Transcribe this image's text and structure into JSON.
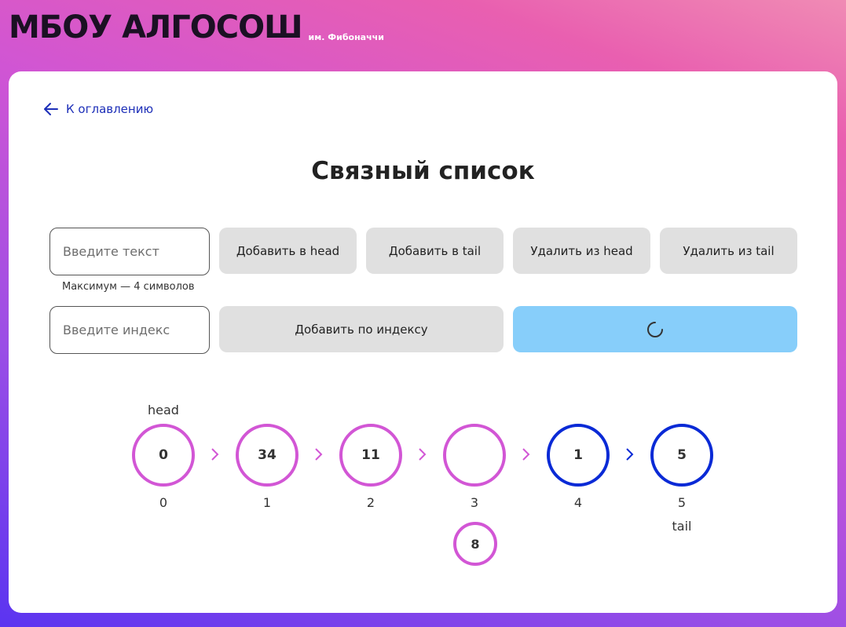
{
  "header": {
    "title": "МБОУ АЛГОСОШ",
    "subtitle": "им. Фибоначчи"
  },
  "nav": {
    "back_label": "К оглавлению"
  },
  "page": {
    "title": "Связный список"
  },
  "controls": {
    "text_input": {
      "placeholder": "Введите текст",
      "value": ""
    },
    "text_hint": "Максимум — 4 символов",
    "index_input": {
      "placeholder": "Введите индекс",
      "value": ""
    },
    "add_head": "Добавить в head",
    "add_tail": "Добавить в tail",
    "remove_head": "Удалить из head",
    "remove_tail": "Удалить из tail",
    "add_by_index": "Добавить по индексу",
    "loading_button_state": "loading"
  },
  "list": {
    "head_label": "head",
    "tail_label": "tail",
    "nodes": [
      {
        "value": "0",
        "index": "0",
        "state": "changing"
      },
      {
        "value": "34",
        "index": "1",
        "state": "changing"
      },
      {
        "value": "11",
        "index": "2",
        "state": "changing"
      },
      {
        "value": "",
        "index": "3",
        "state": "changing"
      },
      {
        "value": "1",
        "index": "4",
        "state": "default"
      },
      {
        "value": "5",
        "index": "5",
        "state": "default"
      }
    ],
    "pending": {
      "value": "8",
      "below_index": "3"
    }
  },
  "colors": {
    "changing": "#d256d5",
    "default": "#0a2ad6",
    "loading_button": "#87cefa",
    "back_link": "#1d2fb8"
  }
}
